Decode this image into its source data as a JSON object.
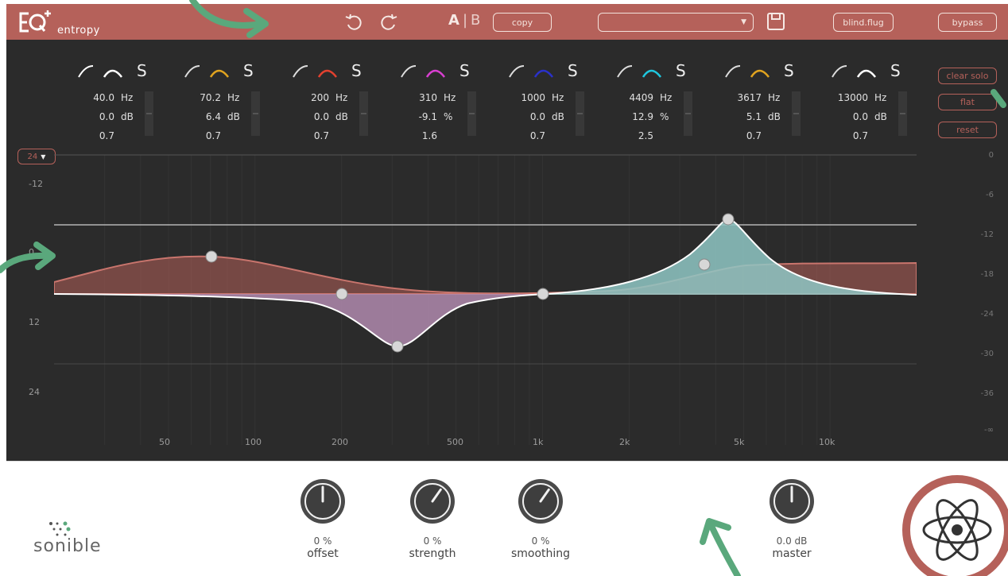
{
  "brand": {
    "name": "entropy",
    "vendor": "sonible"
  },
  "toolbar": {
    "ab_a": "A",
    "ab_b": "B",
    "copy_label": "copy",
    "preset_value": "",
    "blind_label": "blind.flug",
    "bypass_label": "bypass"
  },
  "side_buttons": {
    "clear_solo": "clear solo",
    "flat": "flat",
    "reset": "reset"
  },
  "range_select": "24",
  "bands": [
    {
      "freq": "40.0",
      "freq_unit": "Hz",
      "gain": "0.0",
      "gain_unit": "dB",
      "q": "0.7",
      "solo": "S",
      "color": "#ffffff"
    },
    {
      "freq": "70.2",
      "freq_unit": "Hz",
      "gain": "6.4",
      "gain_unit": "dB",
      "q": "0.7",
      "solo": "S",
      "color": "#e0a31f"
    },
    {
      "freq": "200",
      "freq_unit": "Hz",
      "gain": "0.0",
      "gain_unit": "dB",
      "q": "0.7",
      "solo": "S",
      "color": "#e2412f"
    },
    {
      "freq": "310",
      "freq_unit": "Hz",
      "gain": "-9.1",
      "gain_unit": "%",
      "q": "1.6",
      "solo": "S",
      "color": "#d83fd0"
    },
    {
      "freq": "1000",
      "freq_unit": "Hz",
      "gain": "0.0",
      "gain_unit": "dB",
      "q": "0.7",
      "solo": "S",
      "color": "#2a31c9"
    },
    {
      "freq": "4409",
      "freq_unit": "Hz",
      "gain": "12.9",
      "gain_unit": "%",
      "q": "2.5",
      "solo": "S",
      "color": "#1fc7de"
    },
    {
      "freq": "3617",
      "freq_unit": "Hz",
      "gain": "5.1",
      "gain_unit": "dB",
      "q": "0.7",
      "solo": "S",
      "color": "#e0a31f"
    },
    {
      "freq": "13000",
      "freq_unit": "Hz",
      "gain": "0.0",
      "gain_unit": "dB",
      "q": "0.7",
      "solo": "S",
      "color": "#ffffff"
    }
  ],
  "graph": {
    "left_labels": [
      "-12",
      "0",
      "12",
      "24"
    ],
    "right_labels": [
      "0",
      "-6",
      "-12",
      "-18",
      "-24",
      "-30",
      "-36",
      "-∞"
    ],
    "freq_labels": [
      "50",
      "100",
      "200",
      "500",
      "1k",
      "2k",
      "5k",
      "10k"
    ]
  },
  "knobs": [
    {
      "name": "offset",
      "value": "0 %"
    },
    {
      "name": "strength",
      "value": "0 %"
    },
    {
      "name": "smoothing",
      "value": "0 %"
    },
    {
      "name": "master",
      "value": "0.0 dB"
    }
  ],
  "colors": {
    "accent": "#b5615a",
    "background": "#2b2b2b",
    "curve_teal": "#8fc7c4",
    "curve_purple": "#9c7498"
  }
}
